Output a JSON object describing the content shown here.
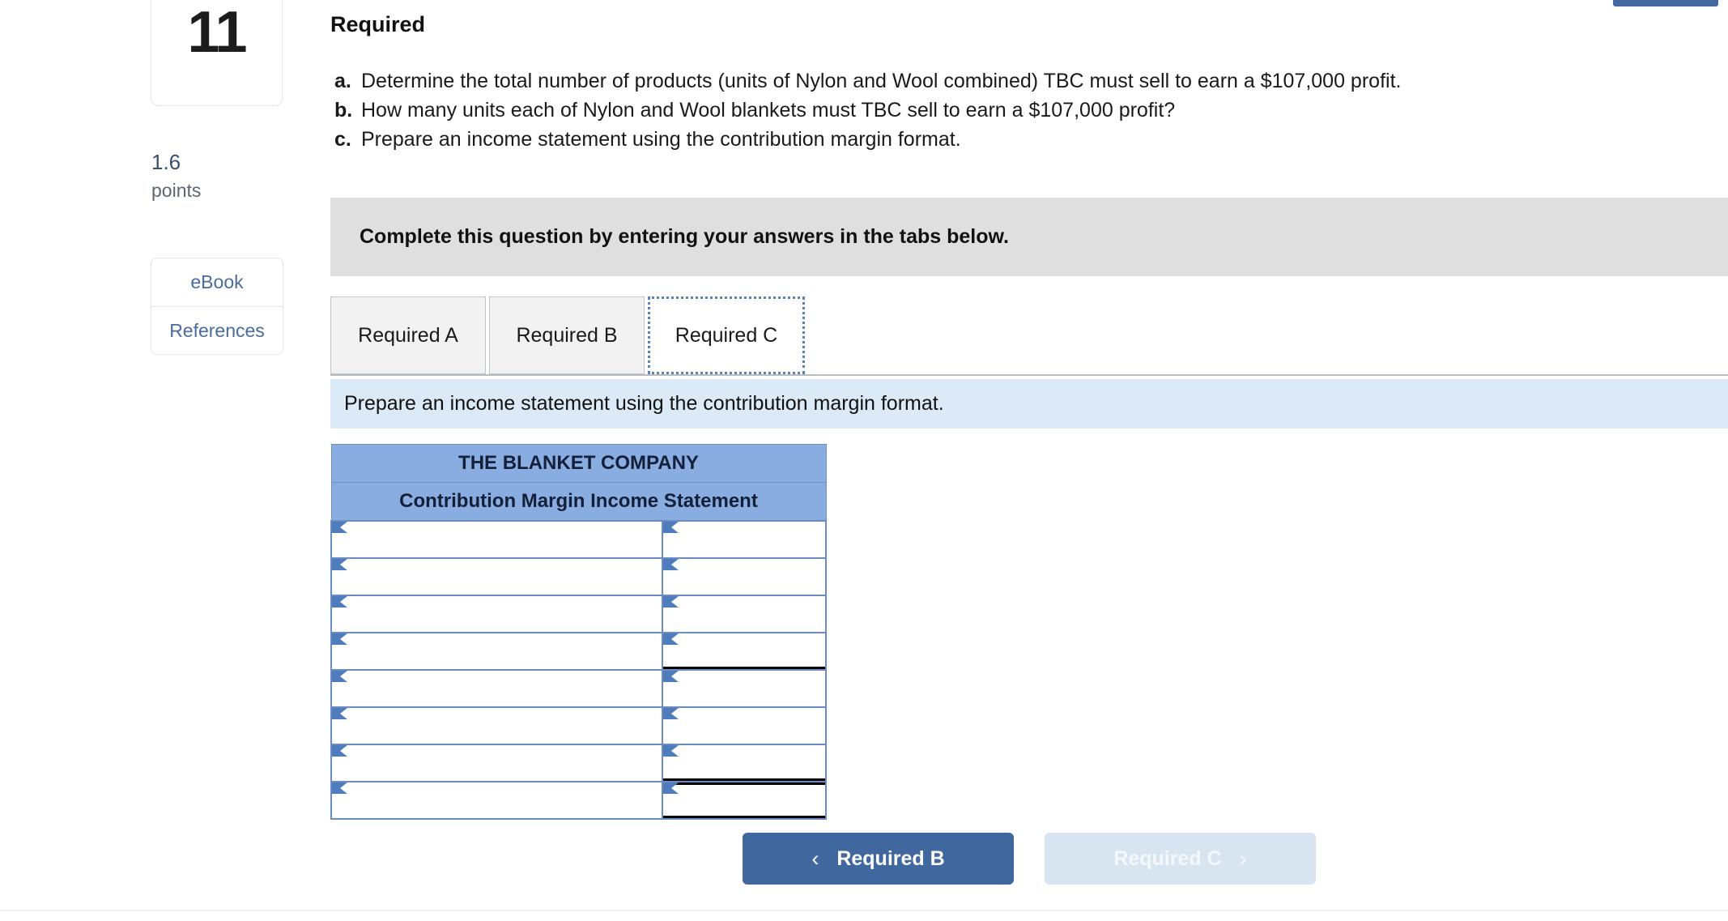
{
  "question": {
    "number": "11",
    "points_value": "1.6",
    "points_label": "points"
  },
  "sidebar": {
    "buttons": [
      {
        "label": "eBook"
      },
      {
        "label": "References"
      }
    ]
  },
  "requirements": {
    "heading": "Required",
    "items": [
      {
        "letter": "a.",
        "text": "Determine the total number of products (units of Nylon and Wool combined) TBC must sell to earn a $107,000 profit."
      },
      {
        "letter": "b.",
        "text": "How many units each of Nylon and Wool blankets must TBC sell to earn a $107,000 profit?"
      },
      {
        "letter": "c.",
        "text": "Prepare an income statement using the contribution margin format."
      }
    ]
  },
  "banner": {
    "text": "Complete this question by entering your answers in the tabs below."
  },
  "tabs": {
    "items": [
      {
        "label": "Required A",
        "active": false
      },
      {
        "label": "Required B",
        "active": false
      },
      {
        "label": "Required C",
        "active": true
      }
    ]
  },
  "instruction": {
    "text": "Prepare an income statement using the contribution margin format."
  },
  "worksheet": {
    "title": "THE BLANKET COMPANY",
    "subtitle": "Contribution Margin Income Statement",
    "rows": [
      {
        "label": "",
        "value": "",
        "style": ""
      },
      {
        "label": "",
        "value": "",
        "style": ""
      },
      {
        "label": "",
        "value": "",
        "style": ""
      },
      {
        "label": "",
        "value": "",
        "style": "subtotal"
      },
      {
        "label": "",
        "value": "",
        "style": ""
      },
      {
        "label": "",
        "value": "",
        "style": ""
      },
      {
        "label": "",
        "value": "",
        "style": "subtotal"
      },
      {
        "label": "",
        "value": "",
        "style": "grand"
      }
    ],
    "cell_placeholder": ""
  },
  "navigation": {
    "prev": {
      "label": "Required B",
      "icon": "chevron-left-icon",
      "glyph": "‹"
    },
    "next": {
      "label": "Required C",
      "icon": "chevron-right-icon",
      "glyph": "›"
    }
  },
  "colors": {
    "header_blue": "#89ade0",
    "cell_border_blue": "#6b8cc0",
    "marker_blue": "#4f7cbd",
    "instruction_blue": "#dce9f7",
    "banner_grey": "#dfdfdf",
    "primary_button": "#40689f",
    "disabled_button": "#d9e4f1",
    "link_blue": "#4a6c9b"
  }
}
